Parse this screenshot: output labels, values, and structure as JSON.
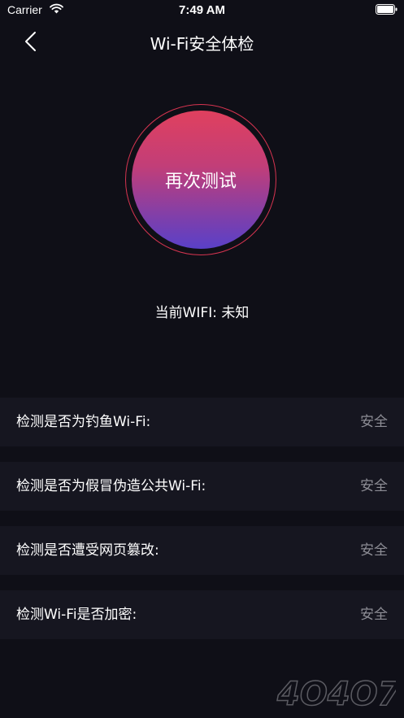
{
  "status_bar": {
    "carrier": "Carrier",
    "time": "7:49 AM"
  },
  "nav": {
    "title": "Wi-Fi安全体检",
    "back_icon": "chevron-left-icon"
  },
  "test_button": {
    "label": "再次测试"
  },
  "current_wifi": "当前WIFI: 未知",
  "checks": [
    {
      "label": "检测是否为钓鱼Wi-Fi:",
      "result": "安全"
    },
    {
      "label": "检测是否为假冒伪造公共Wi-Fi:",
      "result": "安全"
    },
    {
      "label": "检测是否遭受网页篡改:",
      "result": "安全"
    },
    {
      "label": "检测Wi-Fi是否加密:",
      "result": "安全"
    }
  ],
  "watermark": "4O4O7",
  "colors": {
    "background": "#0f0f17",
    "row_background": "#161620",
    "gradient_top": "#e0405e",
    "gradient_bottom": "#5a40c8",
    "ring": "#d63450",
    "result_text": "#8d8d95"
  }
}
